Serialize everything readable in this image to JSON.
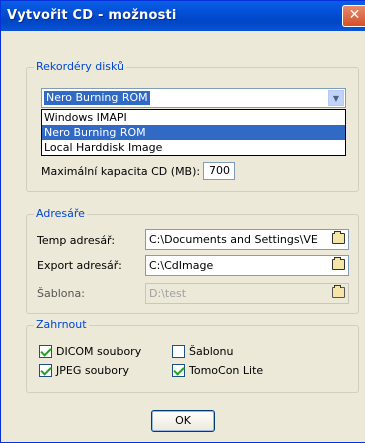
{
  "window": {
    "title": "Vytvořit CD - možnosti",
    "close_glyph": "✕"
  },
  "recorders": {
    "group_label": "Rekordéry disků",
    "selected": "Nero Burning ROM",
    "options": [
      "Windows IMAPI",
      "Nero Burning ROM",
      "Local Harddisk Image"
    ],
    "max_capacity_label": "Maximální kapacita CD (MB):",
    "max_capacity_value": "700"
  },
  "folders": {
    "group_label": "Adresáře",
    "temp_label": "Temp adresář:",
    "temp_value": "C:\\Documents and Settings\\VE",
    "export_label": "Export adresář:",
    "export_value": "C:\\CdImage",
    "template_label": "Šablona:",
    "template_value": "D:\\test"
  },
  "include": {
    "group_label": "Zahrnout",
    "dicom_label": "DICOM soubory",
    "dicom_checked": true,
    "jpeg_label": "JPEG soubory",
    "jpeg_checked": true,
    "template_label": "Šablonu",
    "template_checked": false,
    "tomocon_label": "TomoCon Lite",
    "tomocon_checked": true
  },
  "buttons": {
    "ok_label": "OK"
  }
}
